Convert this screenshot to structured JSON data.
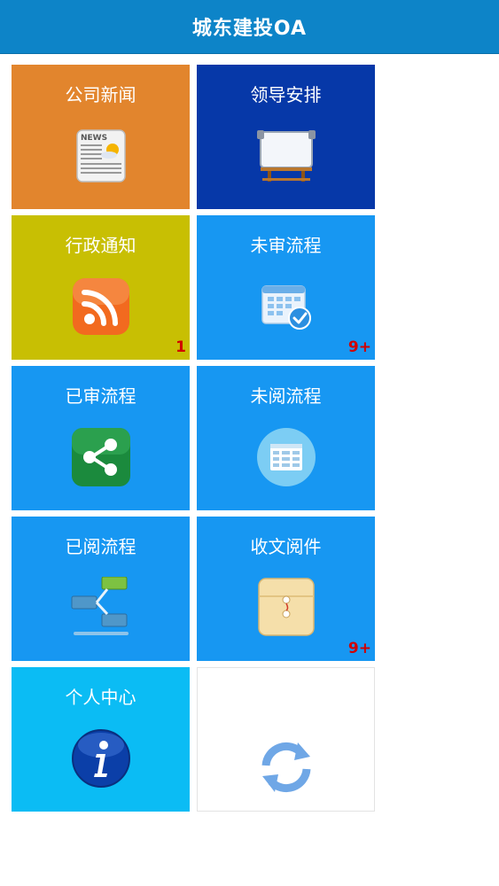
{
  "header": {
    "title": "城东建投OA"
  },
  "tiles": [
    {
      "label": "公司新闻",
      "icon": "newspaper-icon",
      "color": "#e2852d",
      "badge": ""
    },
    {
      "label": "领导安排",
      "icon": "whiteboard-icon",
      "color": "#0638a8",
      "badge": ""
    },
    {
      "label": "行政通知",
      "icon": "rss-icon",
      "color": "#c8bf03",
      "badge": "1"
    },
    {
      "label": "未审流程",
      "icon": "calendar-check-icon",
      "color": "#1797f2",
      "badge": "9+"
    },
    {
      "label": "已审流程",
      "icon": "share-icon",
      "color": "#1797f2",
      "badge": ""
    },
    {
      "label": "未阅流程",
      "icon": "spreadsheet-icon",
      "color": "#1797f2",
      "badge": ""
    },
    {
      "label": "已阅流程",
      "icon": "flowchart-icon",
      "color": "#1797f2",
      "badge": ""
    },
    {
      "label": "收文阅件",
      "icon": "envelope-icon",
      "color": "#1797f2",
      "badge": "9+"
    },
    {
      "label": "个人中心",
      "icon": "info-icon",
      "color": "#0bbcf4",
      "badge": ""
    },
    {
      "label": "",
      "icon": "refresh-icon",
      "color": "#ffffff",
      "badge": ""
    }
  ]
}
